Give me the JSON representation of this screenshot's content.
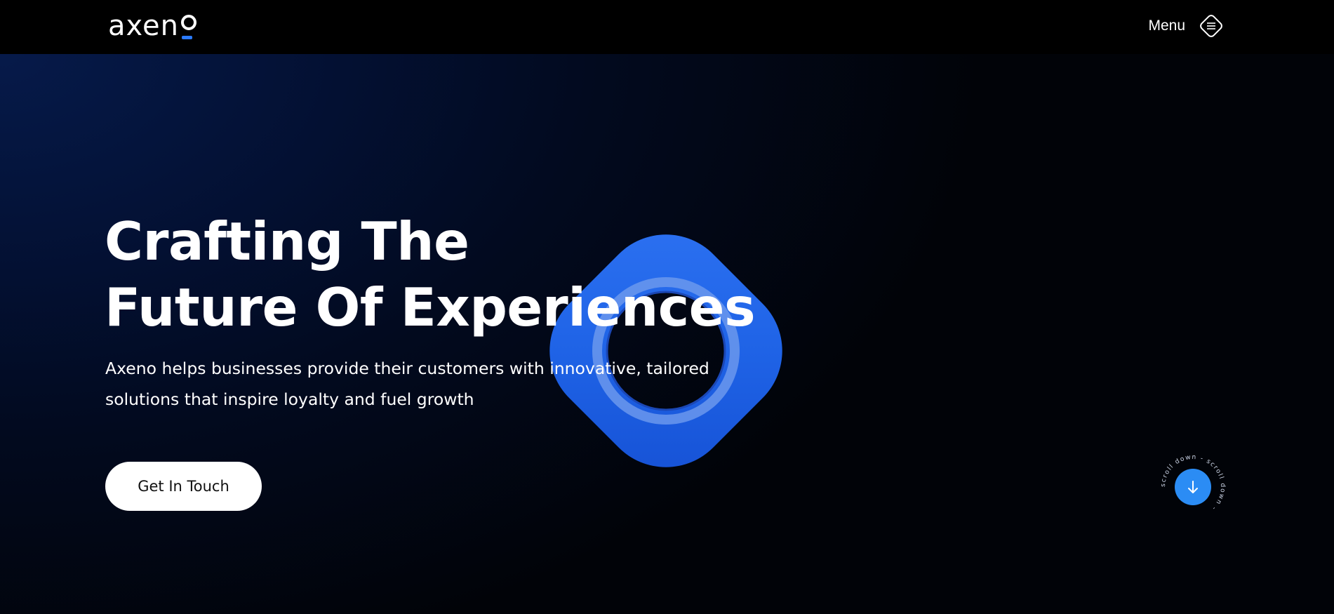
{
  "header": {
    "logo_text": "axen",
    "logo_icon": "logo-o-mark",
    "menu_label": "Menu",
    "menu_icon": "hamburger-diamond-icon"
  },
  "hero": {
    "headline_line1": "Crafting The",
    "headline_line2": "Future Of Experiences",
    "subtext": "Axeno helps businesses provide their customers with innovative, tailored solutions that inspire loyalty and fuel growth",
    "cta_label": "Get In Touch",
    "scroll_text": "scroll down - scroll down - ",
    "scroll_icon": "arrow-down-icon",
    "graphic": "blue-rounded-diamond-with-hole"
  },
  "colors": {
    "accent": "#2b7bff",
    "shape_blue": "#1f63e6",
    "background_dark": "#010308",
    "background_navy": "#061a4a",
    "text": "#ffffff"
  }
}
